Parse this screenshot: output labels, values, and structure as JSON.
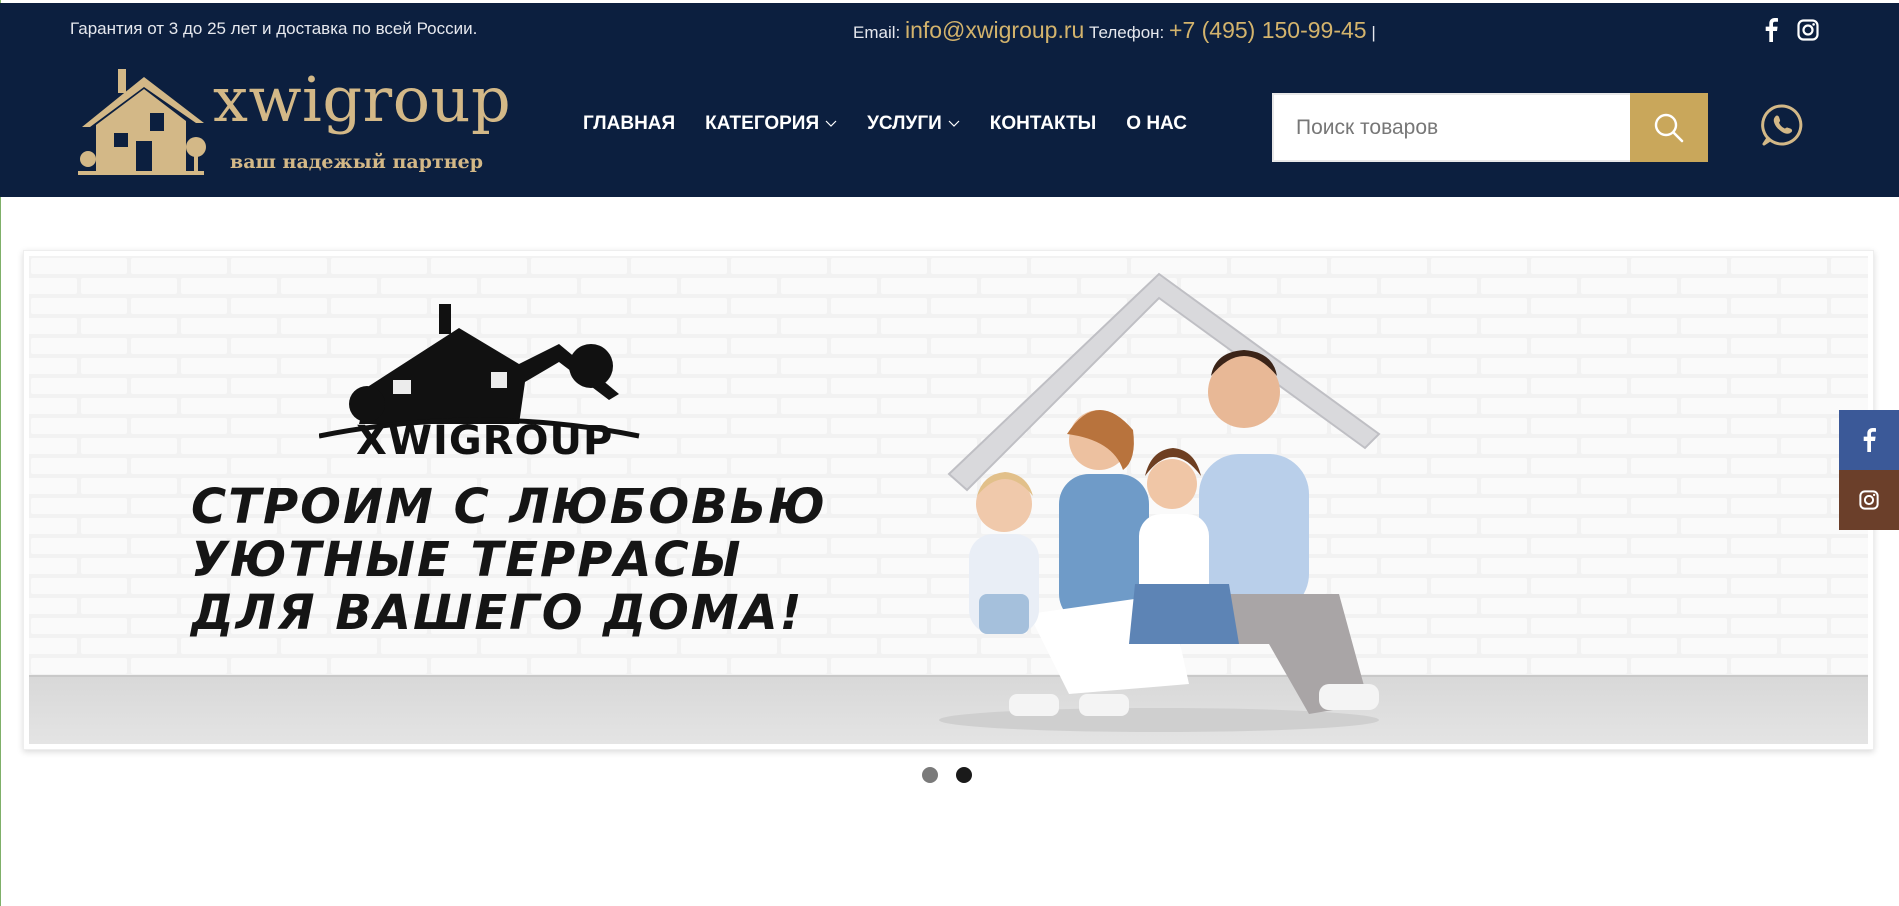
{
  "topbar": {
    "guarantee": "Гарантия от 3 до 25 лет и доставка по всей России.",
    "email_label": "Email:",
    "email": "info@xwigroup.ru",
    "phone_label": "Телефон:",
    "phone": "+7 (495) 150-99-45",
    "separator": "|"
  },
  "logo": {
    "name": "xwigroup",
    "tagline": "ваш надежый партнер"
  },
  "nav": [
    {
      "label": "ГЛАВНАЯ",
      "dropdown": false
    },
    {
      "label": "КАТЕГОРИЯ",
      "dropdown": true
    },
    {
      "label": "УСЛУГИ",
      "dropdown": true
    },
    {
      "label": "КОНТАКТЫ",
      "dropdown": false
    },
    {
      "label": "О НАС",
      "dropdown": false
    }
  ],
  "search": {
    "placeholder": "Поиск товаров",
    "value": ""
  },
  "slider": {
    "brand": "XWIGROUP",
    "headline": [
      "СТРОИМ С ЛЮБОВЬЮ",
      "УЮТНЫЕ ТЕРРАСЫ",
      "ДЛЯ ВАШЕГО ДОМА!"
    ],
    "active_slide": 2,
    "slide_count": 2
  },
  "colors": {
    "header_bg": "#0c1f3f",
    "accent_gold": "#c9a75b",
    "logo_gold": "#d3b887",
    "facebook": "#3b5998",
    "instagram": "#6b3f2a"
  },
  "icons": {
    "facebook": "facebook-icon",
    "instagram": "instagram-icon",
    "search": "search-icon",
    "whatsapp": "whatsapp-icon",
    "chevron": "chevron-down-icon"
  }
}
